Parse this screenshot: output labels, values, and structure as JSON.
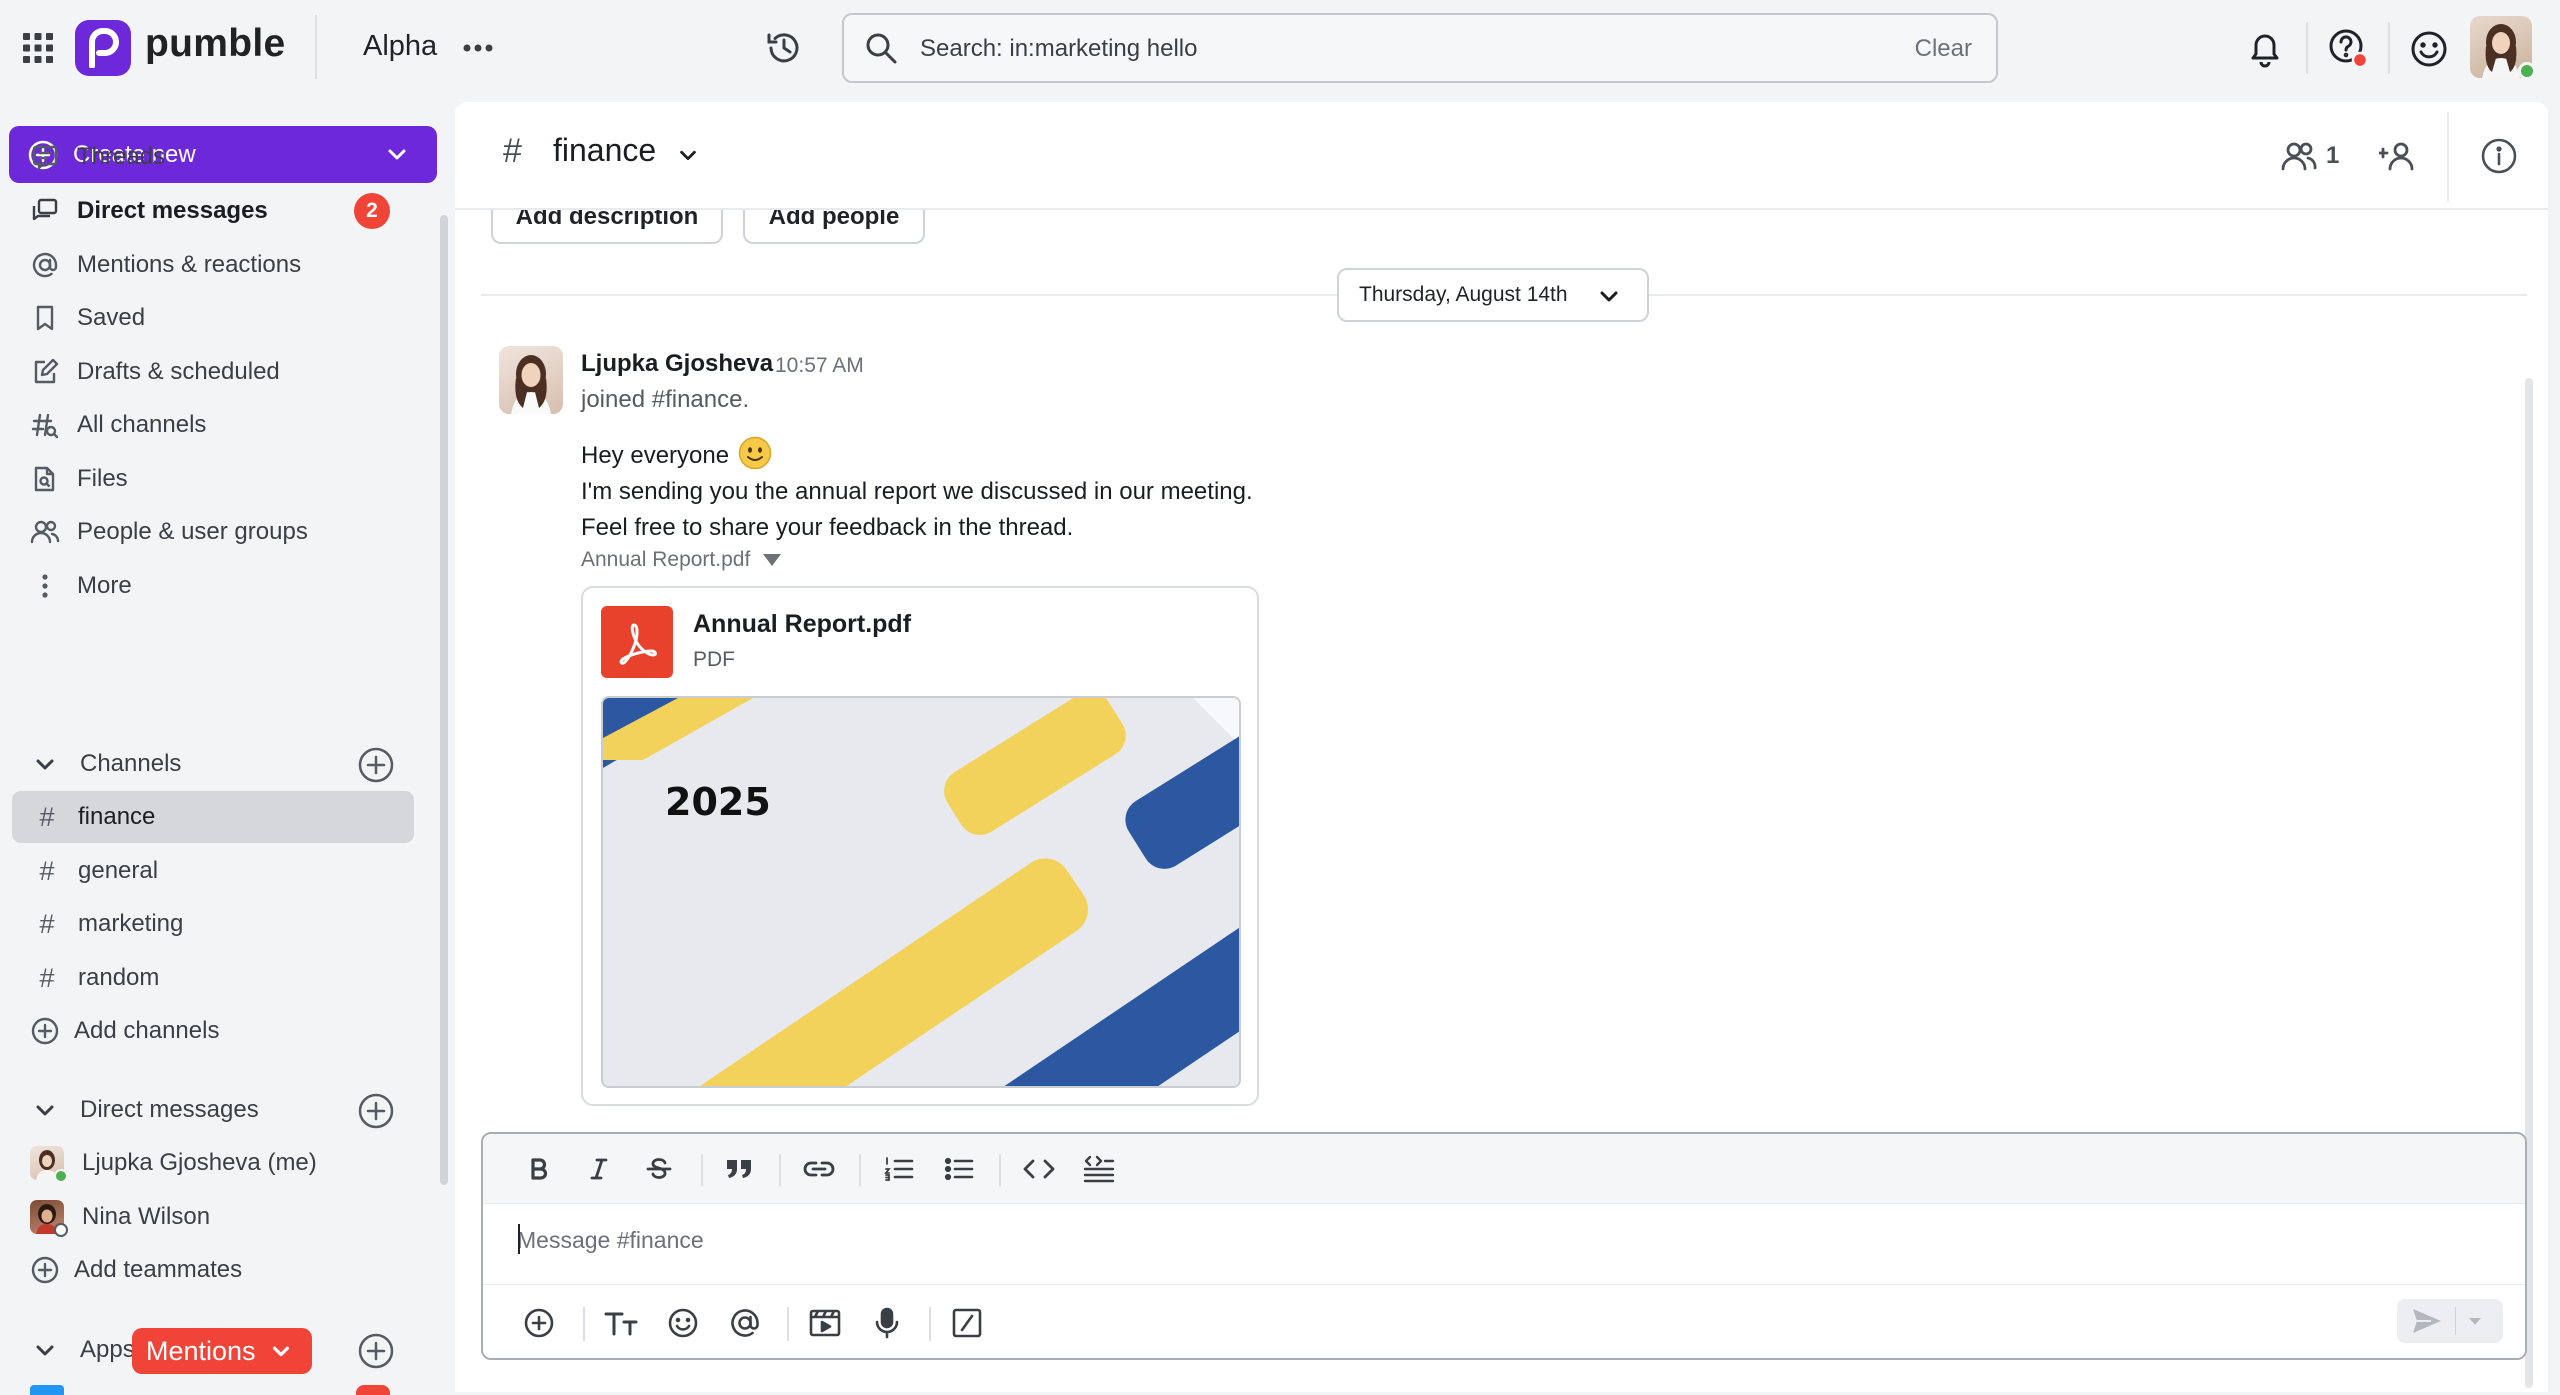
{
  "topbar": {
    "logo_text": "pumble",
    "workspace_name": "Alpha",
    "search_text": "Search: in:marketing hello",
    "search_clear": "Clear"
  },
  "sidebar": {
    "create_new": "Create new",
    "nav": [
      {
        "label": "Threads",
        "icon": "threads-icon"
      },
      {
        "label": "Direct messages",
        "icon": "direct-messages-icon",
        "badge": "2"
      },
      {
        "label": "Mentions & reactions",
        "icon": "at-sign-icon"
      },
      {
        "label": "Saved",
        "icon": "bookmark-icon"
      },
      {
        "label": "Drafts & scheduled",
        "icon": "draft-pen-icon"
      },
      {
        "label": "All channels",
        "icon": "all-channels-icon"
      },
      {
        "label": "Files",
        "icon": "file-search-icon"
      },
      {
        "label": "People & user groups",
        "icon": "people-icon"
      },
      {
        "label": "More",
        "icon": "more-vertical-icon"
      }
    ],
    "channels_header": "Channels",
    "channels": [
      {
        "label": "finance",
        "active": true
      },
      {
        "label": "general"
      },
      {
        "label": "marketing"
      },
      {
        "label": "random"
      }
    ],
    "add_channels": "Add channels",
    "dm_header": "Direct messages",
    "dms": [
      {
        "label": "Ljupka Gjosheva (me)"
      },
      {
        "label": "Nina Wilson"
      }
    ],
    "add_teammates": "Add teammates",
    "apps_header": "Apps",
    "mentions_pill": "Mentions"
  },
  "channel": {
    "name": "finance",
    "member_count": "1",
    "add_description": "Add description",
    "add_people": "Add people",
    "date_divider": "Thursday, August 14th"
  },
  "message": {
    "author": "Ljupka Gjosheva",
    "time": "10:57 AM",
    "joined": "joined #finance.",
    "line1": "Hey everyone",
    "line2": "I'm sending you the annual report we discussed in our meeting.",
    "line3": "Feel free to share your feedback in the thread.",
    "file_caption": "Annual Report.pdf",
    "file": {
      "name": "Annual Report.pdf",
      "type": "PDF",
      "preview_year": "2025"
    }
  },
  "composer": {
    "placeholder": "Message #finance"
  },
  "colors": {
    "brand_purple": "#6d28d9",
    "badge_red": "#f04438",
    "pdf_red": "#e8412c",
    "preview_yellow": "#f2d25a",
    "preview_blue": "#2b58a0"
  }
}
